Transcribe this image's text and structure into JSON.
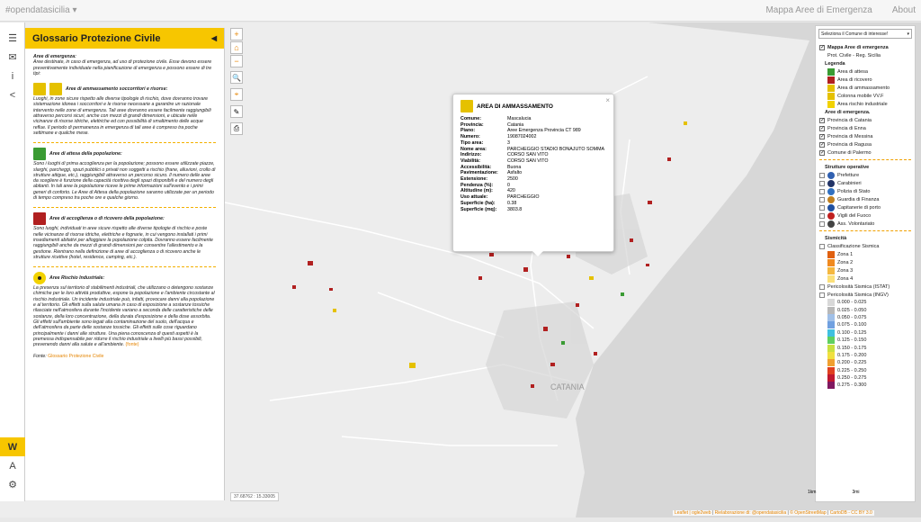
{
  "topbar": {
    "brand": "#opendatasicilia",
    "nav": [
      "Mappa Aree di Emergenza",
      "About"
    ]
  },
  "sidebar": {
    "tabs": [
      {
        "icon": "menu-icon",
        "glyph": "☰"
      },
      {
        "icon": "mail-icon",
        "glyph": "✉"
      },
      {
        "icon": "info-icon",
        "glyph": "i"
      },
      {
        "icon": "share-icon",
        "glyph": "<"
      },
      {
        "icon": "wikipedia-icon",
        "glyph": "W"
      },
      {
        "icon": "font-icon",
        "glyph": "A"
      },
      {
        "icon": "gear-icon",
        "glyph": "⚙"
      }
    ]
  },
  "panel": {
    "title": "Glossario Protezione Civile",
    "intro_title": "Aree di emergenza:",
    "intro_text": "Aree destinate, in caso di emergenza, ad uso di protezione civile. Esse devono essere preventivamente individuate nella pianificazione di emergenza e possono essere di tre tipi:",
    "sections": [
      {
        "title": "Aree di ammassamento soccorritori e risorse:",
        "text": "Luoghi, in zone sicure rispetto alle diverse tipologie di rischio, dove dovranno trovare sistemazione idonea i soccorritori e le risorse necessarie a garantire un razionale intervento nelle zone di emergenza. Tali aree dovranno essere facilmente raggiungibili attraverso percorsi sicuri, anche con mezzi di grandi dimensioni, e ubicate nelle vicinanze di risorse idriche, elettriche ed con possibilità di smaltimento delle acque reflue. Il periodo di permanenza in emergenza di tali aree è compreso tra poche settimane e qualche mese."
      },
      {
        "title": "Aree di attesa della popolazione:",
        "text": "Sono i luoghi di prima accoglienza per la popolazione; possono essere utilizzate piazze, slarghi, parcheggi, spazi pubblici o privati non soggetti a rischio (frane, alluvioni, crollo di strutture attigue, etc.), raggiungibili attraverso un percorso sicuro. Il numero delle aree da scegliere è funzione della capacità ricettiva degli spazi disponibili e del numero degli abitanti. In tali aree la popolazione riceve le prime informazioni sull'evento e i primi generi di conforto. Le Aree di Attesa della popolazione saranno utilizzate per un periodo di tempo compreso tra poche ore e qualche giorno."
      },
      {
        "title": "Aree di accoglienza o di ricovero della popolazione:",
        "text": "Sono luoghi, individuati in aree sicure rispetto alle diverse tipologie di rischio e poste nelle vicinanze di risorse idriche, elettriche e fognarie, in cui vengono installati i primi insediamenti abitativi per alloggiare la popolazione colpita. Dovranno essere facilmente raggiungibili anche da mezzi di grandi dimensioni per consentire l'allestimento e la gestione. Rientrano nella definizione di aree di accoglienza o di ricovero anche le strutture ricettive (hotel, residence, camping, etc.)."
      },
      {
        "title": "Aree Rischio Industriale:",
        "text": "La presenza sul territorio di stabilimenti industriali, che utilizzano o detengono sostanze chimiche per le loro attività produttive, espone la popolazione e l'ambiente circostante al rischio industriale. Un incidente industriale può, infatti, provocare danni alla popolazione e al territorio. Gli effetti sulla salute umana in caso di esposizione a sostanze tossiche rilasciate nell'atmosfera durante l'incidente variano a seconda delle caratteristiche delle sostanze, della loro concentrazione, della durata d'esposizione e della dose assorbita. Gli effetti sull'ambiente sono legati alla contaminazione del suolo, dell'acqua e dell'atmosfera da parte delle sostanze tossiche. Gli effetti sulle cose riguardano principalmente i danni alle strutture. Una piena conoscenza di questi aspetti è la premessa indispensabile per ridurre il rischio industriale a livelli più bassi possibili, prevenendo danni alla salute e all'ambiente.",
        "more": "(fonte)"
      }
    ],
    "source_label": "Fonte:",
    "source_link": "Glossario Protezione Civile"
  },
  "map": {
    "coords": "37.68762 : 15.33005",
    "city_label": "CATANIA",
    "attribution_prefix": "Leaflet | ",
    "attribution_items": [
      "ogle2web",
      "Rielaborazione di: @opendatasicilia",
      "© OpenStreetMap",
      "CartoDB - CC BY 3.0"
    ],
    "scale_left": "1km",
    "scale_right": "3mi"
  },
  "popup": {
    "title": "AREA DI AMMASSAMENTO",
    "rows": [
      {
        "k": "Comune:",
        "v": "Mascalucia"
      },
      {
        "k": "Provincia:",
        "v": "Catania"
      },
      {
        "k": "Piano:",
        "v": "Aree Emergenza Provincia CT 989"
      },
      {
        "k": "Numero:",
        "v": "19087024002"
      },
      {
        "k": "Tipo area:",
        "v": "3"
      },
      {
        "k": "Nome area:",
        "v": "PARCHEGGIO STADIO BONAJUTO SOMMA"
      },
      {
        "k": "Indirizzo:",
        "v": "CORSO SAN VITO"
      },
      {
        "k": "Viabilità:",
        "v": "CORSO SAN VITO"
      },
      {
        "k": "Accessibilità:",
        "v": "Buona"
      },
      {
        "k": "Pavimentazione:",
        "v": "Asfalto"
      },
      {
        "k": "Estensione:",
        "v": "2500"
      },
      {
        "k": "Pendenza (%):",
        "v": "0"
      },
      {
        "k": "Altitudine (m):",
        "v": "420"
      },
      {
        "k": "Uso attuale:",
        "v": "PARCHEGGIO"
      },
      {
        "k": "Superficie (ha):",
        "v": "0.38"
      },
      {
        "k": "Superficie (mq):",
        "v": "3803.8"
      }
    ]
  },
  "layers": {
    "select": "Seleziona il Comune di interesse!",
    "main_title": "Mappa Aree di emergenza",
    "main_sub": "Prot. Civile - Reg. Sicilia",
    "legenda": "Legenda",
    "legend_items": [
      {
        "label": "Area di attesa",
        "color": "#3a9b33"
      },
      {
        "label": "Area di ricovero",
        "color": "#b12020"
      },
      {
        "label": "Area di ammassamento",
        "color": "#e5c100"
      },
      {
        "label": "Colonna mobile VV.F",
        "color": "#e5c100"
      },
      {
        "label": "Area rischio industriale",
        "color": "#f2d200"
      }
    ],
    "aree_title": "Aree di emergenza.",
    "provinces": [
      "Provincia di Catania",
      "Provincia di Enna",
      "Provincia di Messina",
      "Provincia di Ragusa",
      "Comune di Palermo"
    ],
    "strutture_title": "Strutture operative",
    "strutture": [
      {
        "label": "Prefetture",
        "color": "#3060b0"
      },
      {
        "label": "Carabinieri",
        "color": "#223366"
      },
      {
        "label": "Polizia di Stato",
        "color": "#3070c0"
      },
      {
        "label": "Guardia di Finanza",
        "color": "#c08020"
      },
      {
        "label": "Capitanerie di porto",
        "color": "#2050a0"
      },
      {
        "label": "Vigili del Fuoco",
        "color": "#c02020"
      },
      {
        "label": "Ass. Volontariato",
        "color": "#444"
      }
    ],
    "sismicita_title": "Sismicità",
    "classificazione": "Classificazione Sismica",
    "zone": [
      {
        "label": "Zona 1",
        "color": "#e06010"
      },
      {
        "label": "Zona 2",
        "color": "#f08a20"
      },
      {
        "label": "Zona 3",
        "color": "#f5b840"
      },
      {
        "label": "Zona 4",
        "color": "#fbe07a"
      }
    ],
    "pericolosita_istat": "Pericolosità Sismica (ISTAT)",
    "pericolosita_ingv": "Pericolosità Sismica (INGV)",
    "ingv_scale": [
      {
        "label": "0.000 - 0.025",
        "color": "#d8d8d8"
      },
      {
        "label": "0.025 - 0.050",
        "color": "#b8b8b8"
      },
      {
        "label": "0.050 - 0.075",
        "color": "#a0c0e8"
      },
      {
        "label": "0.075 - 0.100",
        "color": "#70a0e0"
      },
      {
        "label": "0.100 - 0.125",
        "color": "#40c0e0"
      },
      {
        "label": "0.125 - 0.150",
        "color": "#60d060"
      },
      {
        "label": "0.150 - 0.175",
        "color": "#c8e040"
      },
      {
        "label": "0.175 - 0.200",
        "color": "#f0e040"
      },
      {
        "label": "0.200 - 0.225",
        "color": "#f0a030"
      },
      {
        "label": "0.225 - 0.250",
        "color": "#e04020"
      },
      {
        "label": "0.250 - 0.275",
        "color": "#c01830"
      },
      {
        "label": "0.275 - 0.300",
        "color": "#801860"
      }
    ]
  }
}
